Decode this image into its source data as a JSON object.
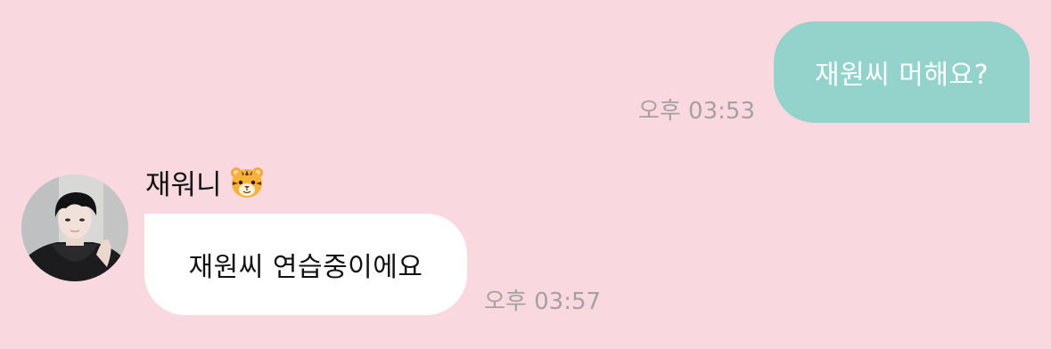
{
  "conversation": {
    "outgoing": {
      "text": "재원씨 머해요?",
      "time": "오후 03:53"
    },
    "incoming": {
      "sender_name": "재워니",
      "sender_emoji_icon": "tiger-face-icon",
      "avatar_icon": "profile-avatar",
      "text": "재원씨 연습중이에요",
      "time": "오후 03:57"
    }
  },
  "colors": {
    "background": "#f9d9df",
    "outgoing_bubble": "#94d3cb",
    "incoming_bubble": "#ffffff",
    "timestamp": "#a7a0a3"
  }
}
